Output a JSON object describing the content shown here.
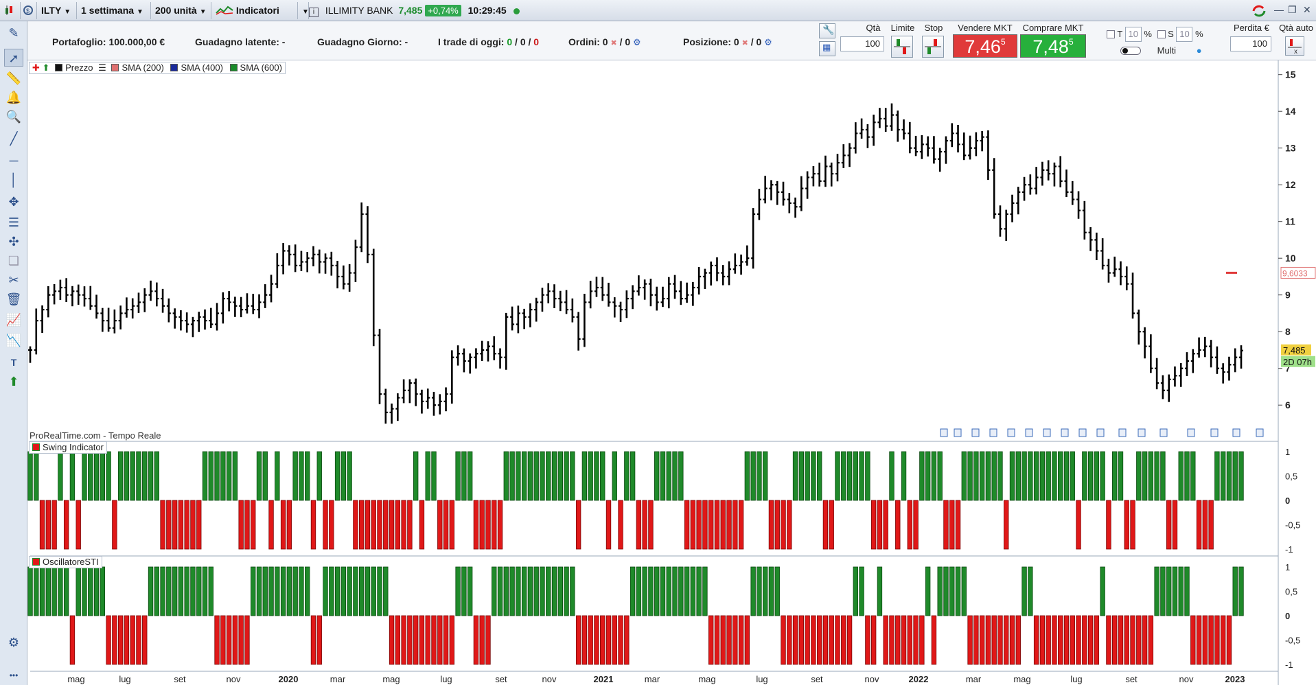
{
  "toolbar": {
    "symbol": "ILTY",
    "period": "1 settimana",
    "units": "200 unità",
    "indicators": "Indicatori",
    "instrument": "ILLIMITY BANK",
    "last": "7,485",
    "change": "+0,74%",
    "time": "10:29:45"
  },
  "info": {
    "portfolio": "Portafoglio: 100.000,00 €",
    "latent": "Guadagno latente: -",
    "day": "Guadagno Giorno: -",
    "trades_label": "I trade di oggi:",
    "trades_a": "0",
    "trades_b": "0",
    "trades_c": "0",
    "orders_label": "Ordini: 0",
    "orders_b": "/ 0",
    "position_label": "Posizione: 0",
    "position_b": "/ 0"
  },
  "order_panel": {
    "qty_label": "Qtà",
    "qty_value": "100",
    "limit_label": "Limite",
    "stop_label": "Stop",
    "sell_label": "Vendere MKT",
    "buy_label": "Comprare MKT",
    "sell_price": "7,46",
    "sell_sup": "5",
    "buy_price": "7,48",
    "buy_sup": "5",
    "t_label": "T",
    "t_value": "10",
    "pct1": "%",
    "s_label": "S",
    "s_value": "10",
    "pct2": "%",
    "multi": "Multi",
    "loss_label": "Perdita €",
    "loss_value": "100",
    "qty_auto": "Qtà auto"
  },
  "legend": {
    "price": "Prezzo",
    "sma200": "SMA (200)",
    "sma400": "SMA (400)",
    "sma600": "SMA (600)",
    "swing": "Swing Indicator",
    "sti": "OscillatoreSTI"
  },
  "watermark": "ProRealTime.com - Tempo Reale",
  "colors": {
    "up": "#1f8a2a",
    "down": "#e01818",
    "sell": "#e03a3a",
    "buy": "#27b03c",
    "sma200": "#e07070",
    "sma400": "#1a2a9a",
    "sma600": "#1a8a2a"
  },
  "chart_data": [
    {
      "type": "bar",
      "subtype": "ohlc-weekly",
      "title": "ILLIMITY BANK",
      "y_ticks": [
        "15",
        "14",
        "13",
        "12",
        "11",
        "10",
        "9",
        "8",
        "7",
        "6"
      ],
      "ylim": [
        5.2,
        15.2
      ],
      "markers": {
        "last": "7,485",
        "timer": "2D 07h",
        "level": "9,6033"
      },
      "x_ticks": [
        "mag",
        "lug",
        "set",
        "nov",
        "2020",
        "mar",
        "mag",
        "lug",
        "set",
        "nov",
        "2021",
        "mar",
        "mag",
        "lug",
        "set",
        "nov",
        "2022",
        "mar",
        "mag",
        "lug",
        "set",
        "nov",
        "2023"
      ],
      "x_ticks_bold": [
        "2020",
        "2021",
        "2022",
        "2023"
      ],
      "close": [
        7.5,
        8.3,
        8.6,
        9.0,
        9.1,
        9.2,
        9.0,
        9.1,
        9.0,
        8.9,
        8.7,
        8.5,
        8.3,
        8.1,
        8.3,
        8.5,
        8.6,
        8.7,
        8.8,
        9.0,
        9.1,
        8.9,
        8.7,
        8.5,
        8.4,
        8.3,
        8.2,
        8.3,
        8.4,
        8.3,
        8.2,
        8.5,
        8.9,
        8.8,
        8.7,
        8.6,
        8.7,
        8.6,
        8.8,
        9.0,
        9.3,
        9.8,
        10.2,
        10.1,
        9.8,
        9.9,
        10.0,
        10.1,
        9.9,
        10.0,
        9.8,
        9.5,
        9.3,
        9.6,
        10.3,
        11.2,
        10.1,
        7.9,
        6.3,
        5.8,
        5.9,
        6.2,
        6.4,
        6.6,
        6.3,
        6.1,
        6.2,
        6.0,
        6.1,
        6.3,
        7.3,
        7.4,
        7.2,
        7.3,
        7.4,
        7.5,
        7.6,
        7.4,
        7.3,
        8.4,
        8.2,
        8.5,
        8.4,
        8.6,
        8.8,
        9.0,
        9.1,
        8.9,
        8.8,
        8.6,
        8.4,
        7.8,
        8.8,
        9.1,
        9.2,
        9.0,
        8.8,
        8.7,
        8.6,
        8.9,
        9.1,
        9.2,
        9.3,
        9.0,
        8.8,
        8.9,
        9.3,
        9.1,
        8.9,
        9.0,
        9.2,
        9.5,
        9.6,
        9.8,
        9.6,
        9.5,
        9.7,
        9.8,
        9.9,
        10.0,
        11.2,
        11.6,
        11.9,
        12.0,
        11.8,
        11.6,
        11.5,
        11.4,
        11.9,
        12.2,
        12.3,
        12.1,
        12.5,
        12.3,
        12.6,
        12.8,
        13.0,
        13.4,
        13.5,
        13.3,
        13.7,
        13.8,
        13.6,
        13.9,
        13.5,
        13.4,
        13.0,
        12.9,
        13.1,
        13.0,
        12.7,
        12.9,
        13.2,
        13.4,
        13.1,
        12.8,
        13.0,
        13.2,
        13.3,
        12.4,
        11.2,
        10.8,
        11.2,
        11.5,
        11.8,
        12.0,
        11.9,
        12.2,
        12.4,
        12.3,
        12.5,
        12.1,
        11.8,
        11.6,
        11.3,
        10.7,
        10.5,
        10.2,
        9.8,
        9.6,
        9.7,
        9.5,
        9.3,
        8.5,
        8.0,
        7.6,
        7.0,
        6.6,
        6.4,
        6.7,
        6.8,
        7.0,
        7.2,
        7.4,
        7.5,
        7.6,
        7.3,
        7.0,
        6.9,
        7.1,
        7.3,
        7.485
      ]
    },
    {
      "type": "bar",
      "title": "Swing Indicator",
      "y_ticks": [
        "1",
        "0,5",
        "0",
        "-0,5",
        "-1"
      ],
      "ylim": [
        -1,
        1
      ],
      "values_pattern": "alternating +1 (green) / -1 (red) weekly bars"
    },
    {
      "type": "bar",
      "title": "OscillatoreSTI",
      "y_ticks": [
        "1",
        "0,5",
        "0",
        "-0,5",
        "-1"
      ],
      "ylim": [
        -1,
        1
      ],
      "values_pattern": "alternating +1 (green) / -1 (red) weekly bars"
    }
  ]
}
